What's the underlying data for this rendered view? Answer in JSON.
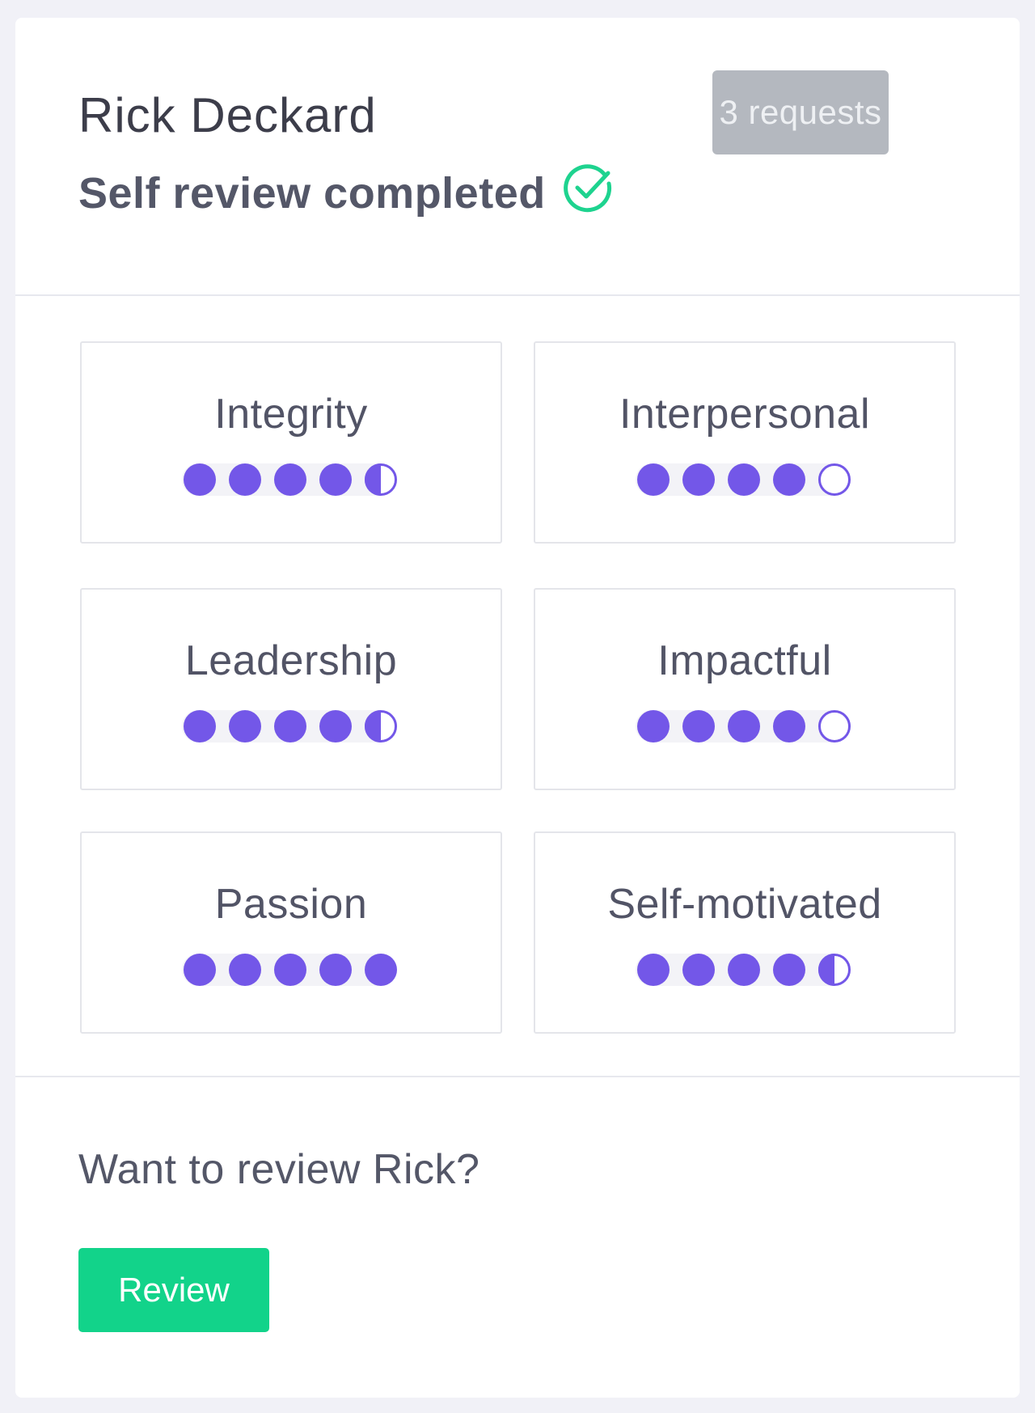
{
  "person": {
    "name": "Rick Deckard",
    "status_text": "Self review completed",
    "status_icon": "check-circle-icon"
  },
  "requests_button": {
    "label": "3 requests"
  },
  "colors": {
    "rating_fill": "#7357e8",
    "success": "#1ed38f",
    "review_button": "#12d38a",
    "requests_button": "#b4b8bf"
  },
  "traits": [
    {
      "label": "Integrity",
      "rating": 4.5,
      "max": 5
    },
    {
      "label": "Interpersonal",
      "rating": 4,
      "max": 5
    },
    {
      "label": "Leadership",
      "rating": 4.5,
      "max": 5
    },
    {
      "label": "Impactful",
      "rating": 4,
      "max": 5
    },
    {
      "label": "Passion",
      "rating": 5,
      "max": 5
    },
    {
      "label": "Self-motivated",
      "rating": 4.5,
      "max": 5
    }
  ],
  "review": {
    "prompt": "Want to review Rick?",
    "button_label": "Review"
  }
}
